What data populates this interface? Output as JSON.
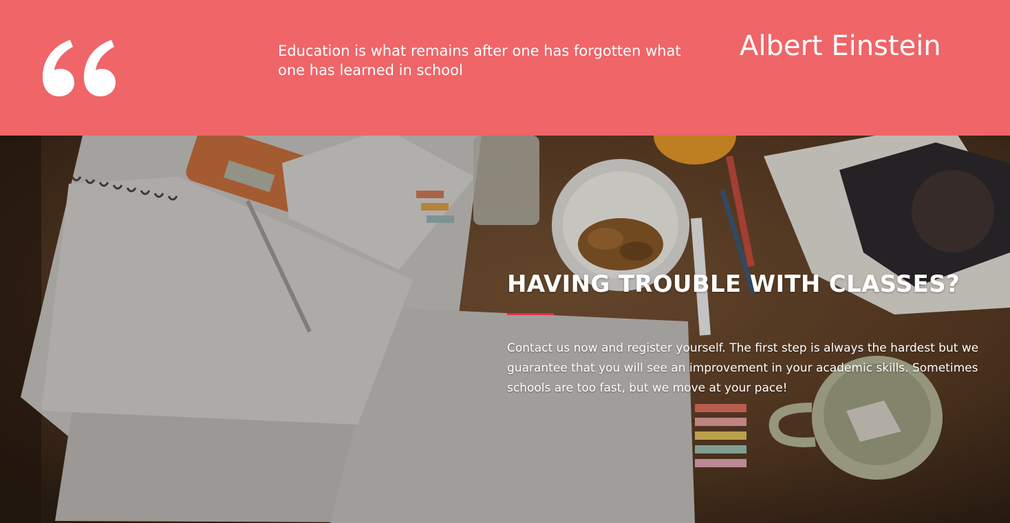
{
  "quote": {
    "text": "Education is what remains after one has forgotten what one has learned in school",
    "author": "Albert Einstein",
    "mark_icon": "quote-mark-icon"
  },
  "hero": {
    "title": "HAVING TROUBLE WITH CLASSES?",
    "body": "Contact us now and register yourself. The first step is always the hardest but we guarantee that you will see an improvement in your academic skills. Sometimes schools are too fast, but we move at your pace!",
    "background": "study-desk-photo"
  },
  "colors": {
    "quote_band": "#ef6568",
    "accent_rule": "#e6314b",
    "text": "#ffffff"
  }
}
